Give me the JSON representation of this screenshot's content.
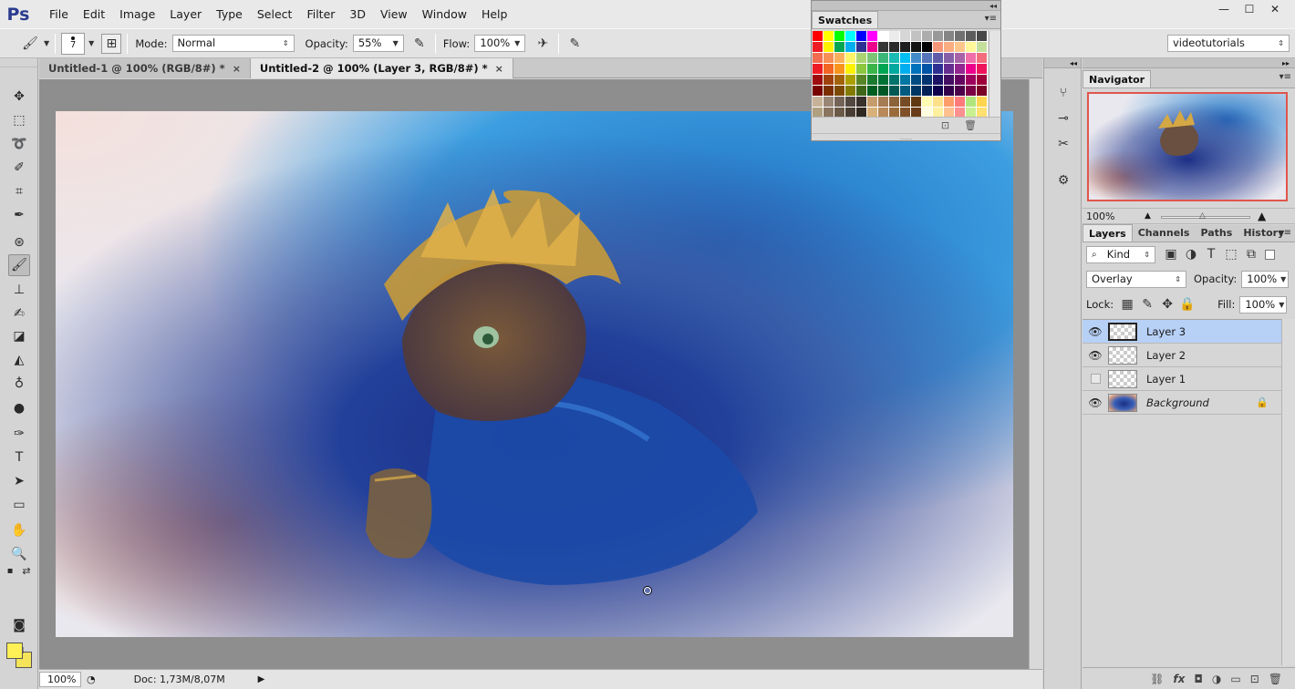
{
  "app": {
    "logo": "Ps"
  },
  "menu": [
    "File",
    "Edit",
    "Image",
    "Layer",
    "Type",
    "Select",
    "Filter",
    "3D",
    "View",
    "Window",
    "Help"
  ],
  "window_controls": {
    "minimize": "—",
    "maximize": "☐",
    "close": "✕"
  },
  "options": {
    "brush_size": "7",
    "mode_label": "Mode:",
    "mode_value": "Normal",
    "opacity_label": "Opacity:",
    "opacity_value": "55%",
    "flow_label": "Flow:",
    "flow_value": "100%",
    "workspace": "videotutorials"
  },
  "tabs": [
    {
      "label": "Untitled-1 @ 100% (RGB/8#) *",
      "close": "×"
    },
    {
      "label": "Untitled-2 @ 100% (Layer 3, RGB/8#) *",
      "close": "×"
    }
  ],
  "status": {
    "zoom": "100%",
    "doc": "Doc: 1,73M/8,07M",
    "arrow": "▶"
  },
  "swatches": {
    "title": "Swatches",
    "collapse": "◂◂",
    "menu": "▾≡",
    "grip": "......",
    "footer_new": "⊡",
    "footer_delete": "🗑"
  },
  "navigator": {
    "title": "Navigator",
    "zoom": "100%",
    "zoom_fraction": 0.45,
    "menu": "▾≡"
  },
  "layers_panel": {
    "tabs": [
      "Layers",
      "Channels",
      "Paths",
      "History"
    ],
    "menu": "▾≡",
    "filter_kind": "Kind",
    "blend_mode": "Overlay",
    "opacity_label": "Opacity:",
    "opacity_value": "100%",
    "lock_label": "Lock:",
    "fill_label": "Fill:",
    "fill_value": "100%",
    "layers": [
      {
        "name": "Layer 3",
        "visible": true,
        "selected": true
      },
      {
        "name": "Layer 2",
        "visible": true,
        "selected": false
      },
      {
        "name": "Layer 1",
        "visible": false,
        "selected": false
      },
      {
        "name": "Background",
        "visible": true,
        "selected": false,
        "locked": true
      }
    ],
    "footer_icons": [
      "link-icon",
      "fx-icon",
      "mask-icon",
      "adjustment-icon",
      "group-icon",
      "new-layer-icon",
      "trash-icon"
    ]
  },
  "colors": {
    "foreground": "#fff055",
    "background": "#f5e35a",
    "selection": "#b7d0f6",
    "navigator_frame": "#e0554d"
  }
}
